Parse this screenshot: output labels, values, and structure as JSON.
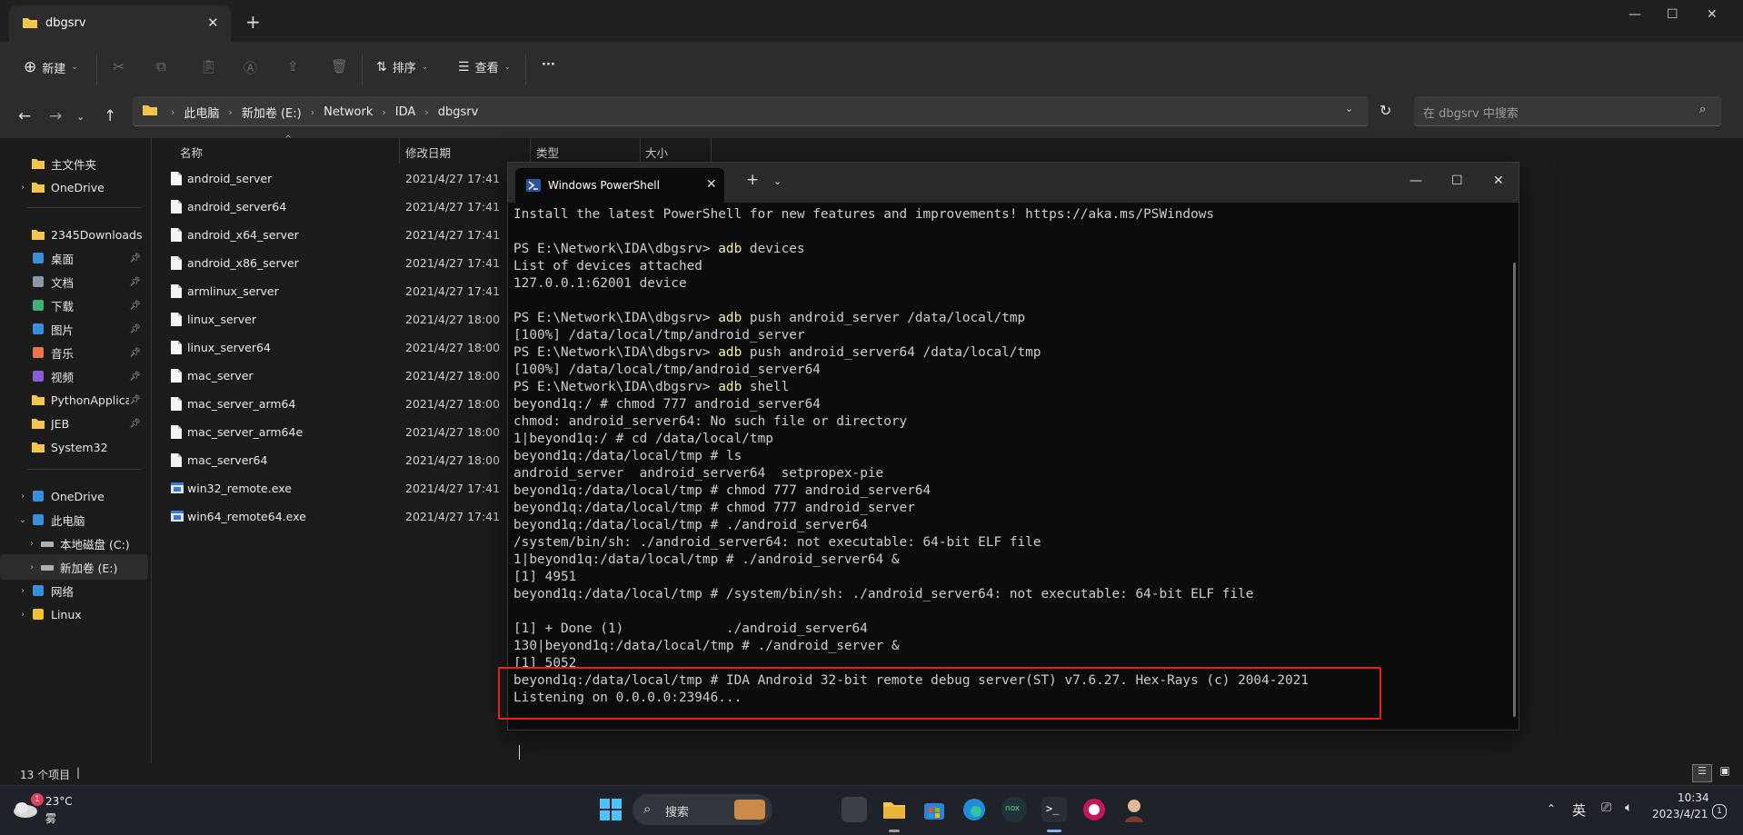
{
  "explorer": {
    "tab_title": "dbgsrv",
    "toolbar": {
      "new_label": "新建",
      "sort_label": "排序",
      "view_label": "查看",
      "more_label": "···"
    },
    "breadcrumbs": [
      "此电脑",
      "新加卷 (E:)",
      "Network",
      "IDA",
      "dbgsrv"
    ],
    "search_placeholder": "在 dbgsrv 中搜索",
    "columns": [
      "名称",
      "修改日期",
      "类型",
      "大小"
    ],
    "sidebar": [
      {
        "label": "主文件夹",
        "icon": "home-icon"
      },
      {
        "label": "OneDrive",
        "icon": "folder-icon"
      },
      {
        "label": "2345Downloads",
        "icon": "folder-icon"
      },
      {
        "label": "桌面",
        "icon": "desktop-icon"
      },
      {
        "label": "文档",
        "icon": "documents-icon"
      },
      {
        "label": "下载",
        "icon": "download-icon"
      },
      {
        "label": "图片",
        "icon": "pictures-icon"
      },
      {
        "label": "音乐",
        "icon": "music-icon"
      },
      {
        "label": "视频",
        "icon": "videos-icon"
      },
      {
        "label": "PythonApplication",
        "icon": "folder-icon"
      },
      {
        "label": "JEB",
        "icon": "folder-icon"
      },
      {
        "label": "System32",
        "icon": "folder-icon"
      },
      {
        "label": "OneDrive",
        "icon": "onedrive-icon"
      },
      {
        "label": "此电脑",
        "icon": "computer-icon"
      },
      {
        "label": "本地磁盘 (C:)",
        "icon": "drive-icon"
      },
      {
        "label": "新加卷 (E:)",
        "icon": "drive-icon"
      },
      {
        "label": "网络",
        "icon": "network-icon"
      },
      {
        "label": "Linux",
        "icon": "linux-icon"
      }
    ],
    "files": [
      {
        "name": "android_server",
        "date": "2021/4/27 17:41"
      },
      {
        "name": "android_server64",
        "date": "2021/4/27 17:41"
      },
      {
        "name": "android_x64_server",
        "date": "2021/4/27 17:41"
      },
      {
        "name": "android_x86_server",
        "date": "2021/4/27 17:41"
      },
      {
        "name": "armlinux_server",
        "date": "2021/4/27 17:41"
      },
      {
        "name": "linux_server",
        "date": "2021/4/27 18:00"
      },
      {
        "name": "linux_server64",
        "date": "2021/4/27 18:00"
      },
      {
        "name": "mac_server",
        "date": "2021/4/27 18:00"
      },
      {
        "name": "mac_server_arm64",
        "date": "2021/4/27 18:00"
      },
      {
        "name": "mac_server_arm64e",
        "date": "2021/4/27 18:00"
      },
      {
        "name": "mac_server64",
        "date": "2021/4/27 18:00"
      },
      {
        "name": "win32_remote.exe",
        "date": "2021/4/27 17:41"
      },
      {
        "name": "win64_remote64.exe",
        "date": "2021/4/27 17:41"
      }
    ],
    "status_count": "13 个项目"
  },
  "terminal": {
    "tab_title": "Windows PowerShell",
    "lines": [
      {
        "t": "Install the latest PowerShell for new features and improvements! https://aka.ms/PSWindows"
      },
      {
        "t": ""
      },
      {
        "p": "PS E:\\Network\\IDA\\dbgsrv> ",
        "c": "adb",
        "r": " devices"
      },
      {
        "t": "List of devices attached"
      },
      {
        "t": "127.0.0.1:62001 device"
      },
      {
        "t": ""
      },
      {
        "p": "PS E:\\Network\\IDA\\dbgsrv> ",
        "c": "adb",
        "r": " push android_server /data/local/tmp"
      },
      {
        "t": "[100%] /data/local/tmp/android_server"
      },
      {
        "p": "PS E:\\Network\\IDA\\dbgsrv> ",
        "c": "adb",
        "r": " push android_server64 /data/local/tmp"
      },
      {
        "t": "[100%] /data/local/tmp/android_server64"
      },
      {
        "p": "PS E:\\Network\\IDA\\dbgsrv> ",
        "c": "adb",
        "r": " shell"
      },
      {
        "t": "beyond1q:/ # chmod 777 android_server64"
      },
      {
        "t": "chmod: android_server64: No such file or directory"
      },
      {
        "t": "1|beyond1q:/ # cd /data/local/tmp"
      },
      {
        "t": "beyond1q:/data/local/tmp # ls"
      },
      {
        "t": "android_server  android_server64  setpropex-pie"
      },
      {
        "t": "beyond1q:/data/local/tmp # chmod 777 android_server64"
      },
      {
        "t": "beyond1q:/data/local/tmp # chmod 777 android_server"
      },
      {
        "t": "beyond1q:/data/local/tmp # ./android_server64"
      },
      {
        "t": "/system/bin/sh: ./android_server64: not executable: 64-bit ELF file"
      },
      {
        "t": "1|beyond1q:/data/local/tmp # ./android_server64 &"
      },
      {
        "t": "[1] 4951"
      },
      {
        "t": "beyond1q:/data/local/tmp # /system/bin/sh: ./android_server64: not executable: 64-bit ELF file"
      },
      {
        "t": ""
      },
      {
        "t": "[1] + Done (1)             ./android_server64"
      },
      {
        "t": "130|beyond1q:/data/local/tmp # ./android_server &"
      },
      {
        "t": "[1] 5052"
      },
      {
        "t": "beyond1q:/data/local/tmp # IDA Android 32-bit remote debug server(ST) v7.6.27. Hex-Rays (c) 2004-2021"
      },
      {
        "t": "Listening on 0.0.0.0:23946..."
      }
    ]
  },
  "taskbar": {
    "weather_temp": "23°C",
    "weather_cond": "雾",
    "weather_badge": "1",
    "search_label": "搜索",
    "ime": "英",
    "time": "10:34",
    "date": "2023/4/21",
    "notif_badge": "1"
  },
  "colors": {
    "accent_highlight": "#e52121",
    "folder": "#f4c44d",
    "ps_blue": "#2b5797",
    "cmd_yellow": "#f9f1a5"
  }
}
